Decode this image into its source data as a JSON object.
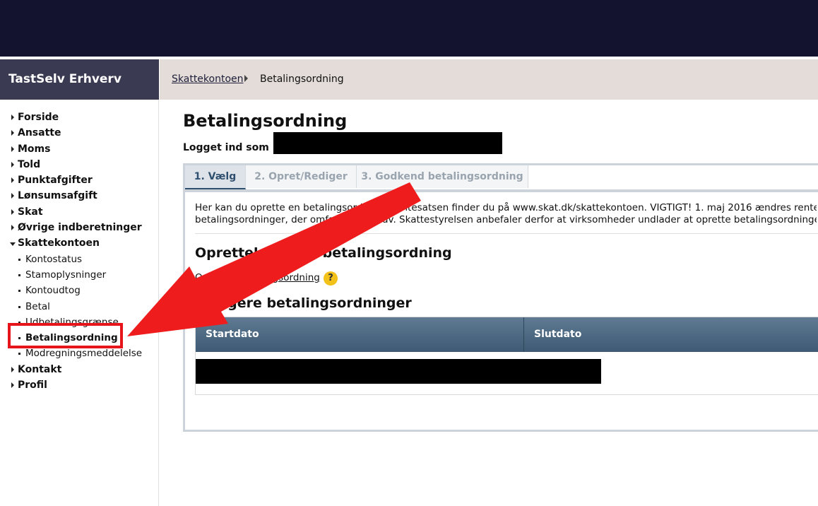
{
  "app": {
    "brand": "TastSelv Erhverv"
  },
  "breadcrumb": {
    "parent": "Skattekontoen",
    "current": "Betalingsordning"
  },
  "sidebar": {
    "items": [
      {
        "label": "Forside"
      },
      {
        "label": "Ansatte"
      },
      {
        "label": "Moms"
      },
      {
        "label": "Told"
      },
      {
        "label": "Punktafgifter"
      },
      {
        "label": "Lønsumsafgift"
      },
      {
        "label": "Skat"
      },
      {
        "label": "Øvrige indberetninger"
      },
      {
        "label": "Skattekontoen"
      }
    ],
    "subitems": [
      {
        "label": "Kontostatus"
      },
      {
        "label": "Stamoplysninger"
      },
      {
        "label": "Kontoudtog"
      },
      {
        "label": "Betal"
      },
      {
        "label": "Udbetalingsgrænse"
      },
      {
        "label": "Betalingsordning"
      },
      {
        "label": "Modregningsmeddelelse"
      }
    ],
    "bottom_items": [
      {
        "label": "Kontakt"
      },
      {
        "label": "Profil"
      }
    ]
  },
  "page": {
    "title": "Betalingsordning",
    "logged_in_label": "Logget ind som"
  },
  "tabs": [
    {
      "label": "1. Vælg"
    },
    {
      "label": "2. Opret/Rediger"
    },
    {
      "label": "3. Godkend betalingsordning"
    }
  ],
  "content": {
    "intro_line1": "Her kan du oprette en betalingsordning. Rentesatsen finder du på www.skat.dk/skattekontoen. VIGTIGT! 1. maj 2016 ændres rente",
    "intro_line2": "betalingsordninger, der omfatter restkrav. Skattestyrelsen anbefaler derfor at virksomheder undlader at oprette betalingsordninger",
    "section1_title": "Oprettelse af ny betalingsordning",
    "create_link": "Opret ny betalingsordning",
    "help_glyph": "?",
    "section2_title": "Tidligere betalingsordninger",
    "table_headers": [
      "Startdato",
      "Slutdato"
    ]
  },
  "colors": {
    "topbar": "#13132f",
    "brand_bg": "#3a3a52",
    "crumb_bg": "#e3dcd9",
    "table_header": "#4a657e",
    "highlight": "#e8141b",
    "help_icon": "#f3c21a"
  }
}
